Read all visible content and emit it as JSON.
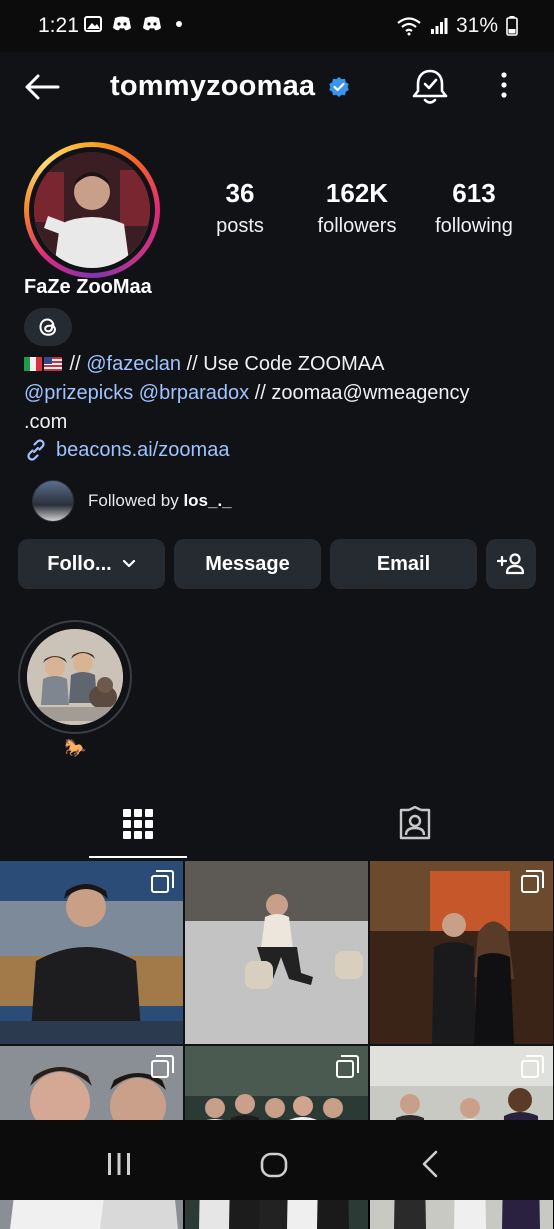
{
  "status_bar": {
    "time": "1:21",
    "battery": "31%"
  },
  "header": {
    "username": "tommyzoomaa"
  },
  "profile": {
    "display_name": "FaZe ZooMaa",
    "stats": [
      {
        "value": "36",
        "label": "posts"
      },
      {
        "value": "162K",
        "label": "followers"
      },
      {
        "value": "613",
        "label": "following"
      }
    ],
    "bio": {
      "line1_sep1": " // ",
      "line1_link": "@fazeclan",
      "line1_rest": " // Use Code ZOOMAA",
      "line2_link1": "@prizepicks",
      "line2_link2": "@brparadox",
      "line2_rest": "  // zoomaa@wmeagency",
      "line3": ".com"
    },
    "external_link": "beacons.ai/zoomaa",
    "followed_by_prefix": "Followed by ",
    "followed_by_user": "los_._"
  },
  "actions": {
    "follow_label": "Follo...",
    "message_label": "Message",
    "email_label": "Email"
  },
  "highlights": [
    {
      "label": "🐎"
    }
  ],
  "icons": {
    "back": "back-arrow-icon",
    "verified": "verified-badge-icon",
    "notifications": "bell-check-icon",
    "more": "kebab-menu-icon",
    "threads": "threads-icon",
    "link": "link-icon",
    "add_user": "add-person-icon",
    "grid": "grid-icon",
    "tagged": "tagged-person-icon"
  },
  "colors": {
    "verified_blue": "#3797f0",
    "link_blue": "#9fc3ff",
    "button_bg": "#262a31"
  }
}
